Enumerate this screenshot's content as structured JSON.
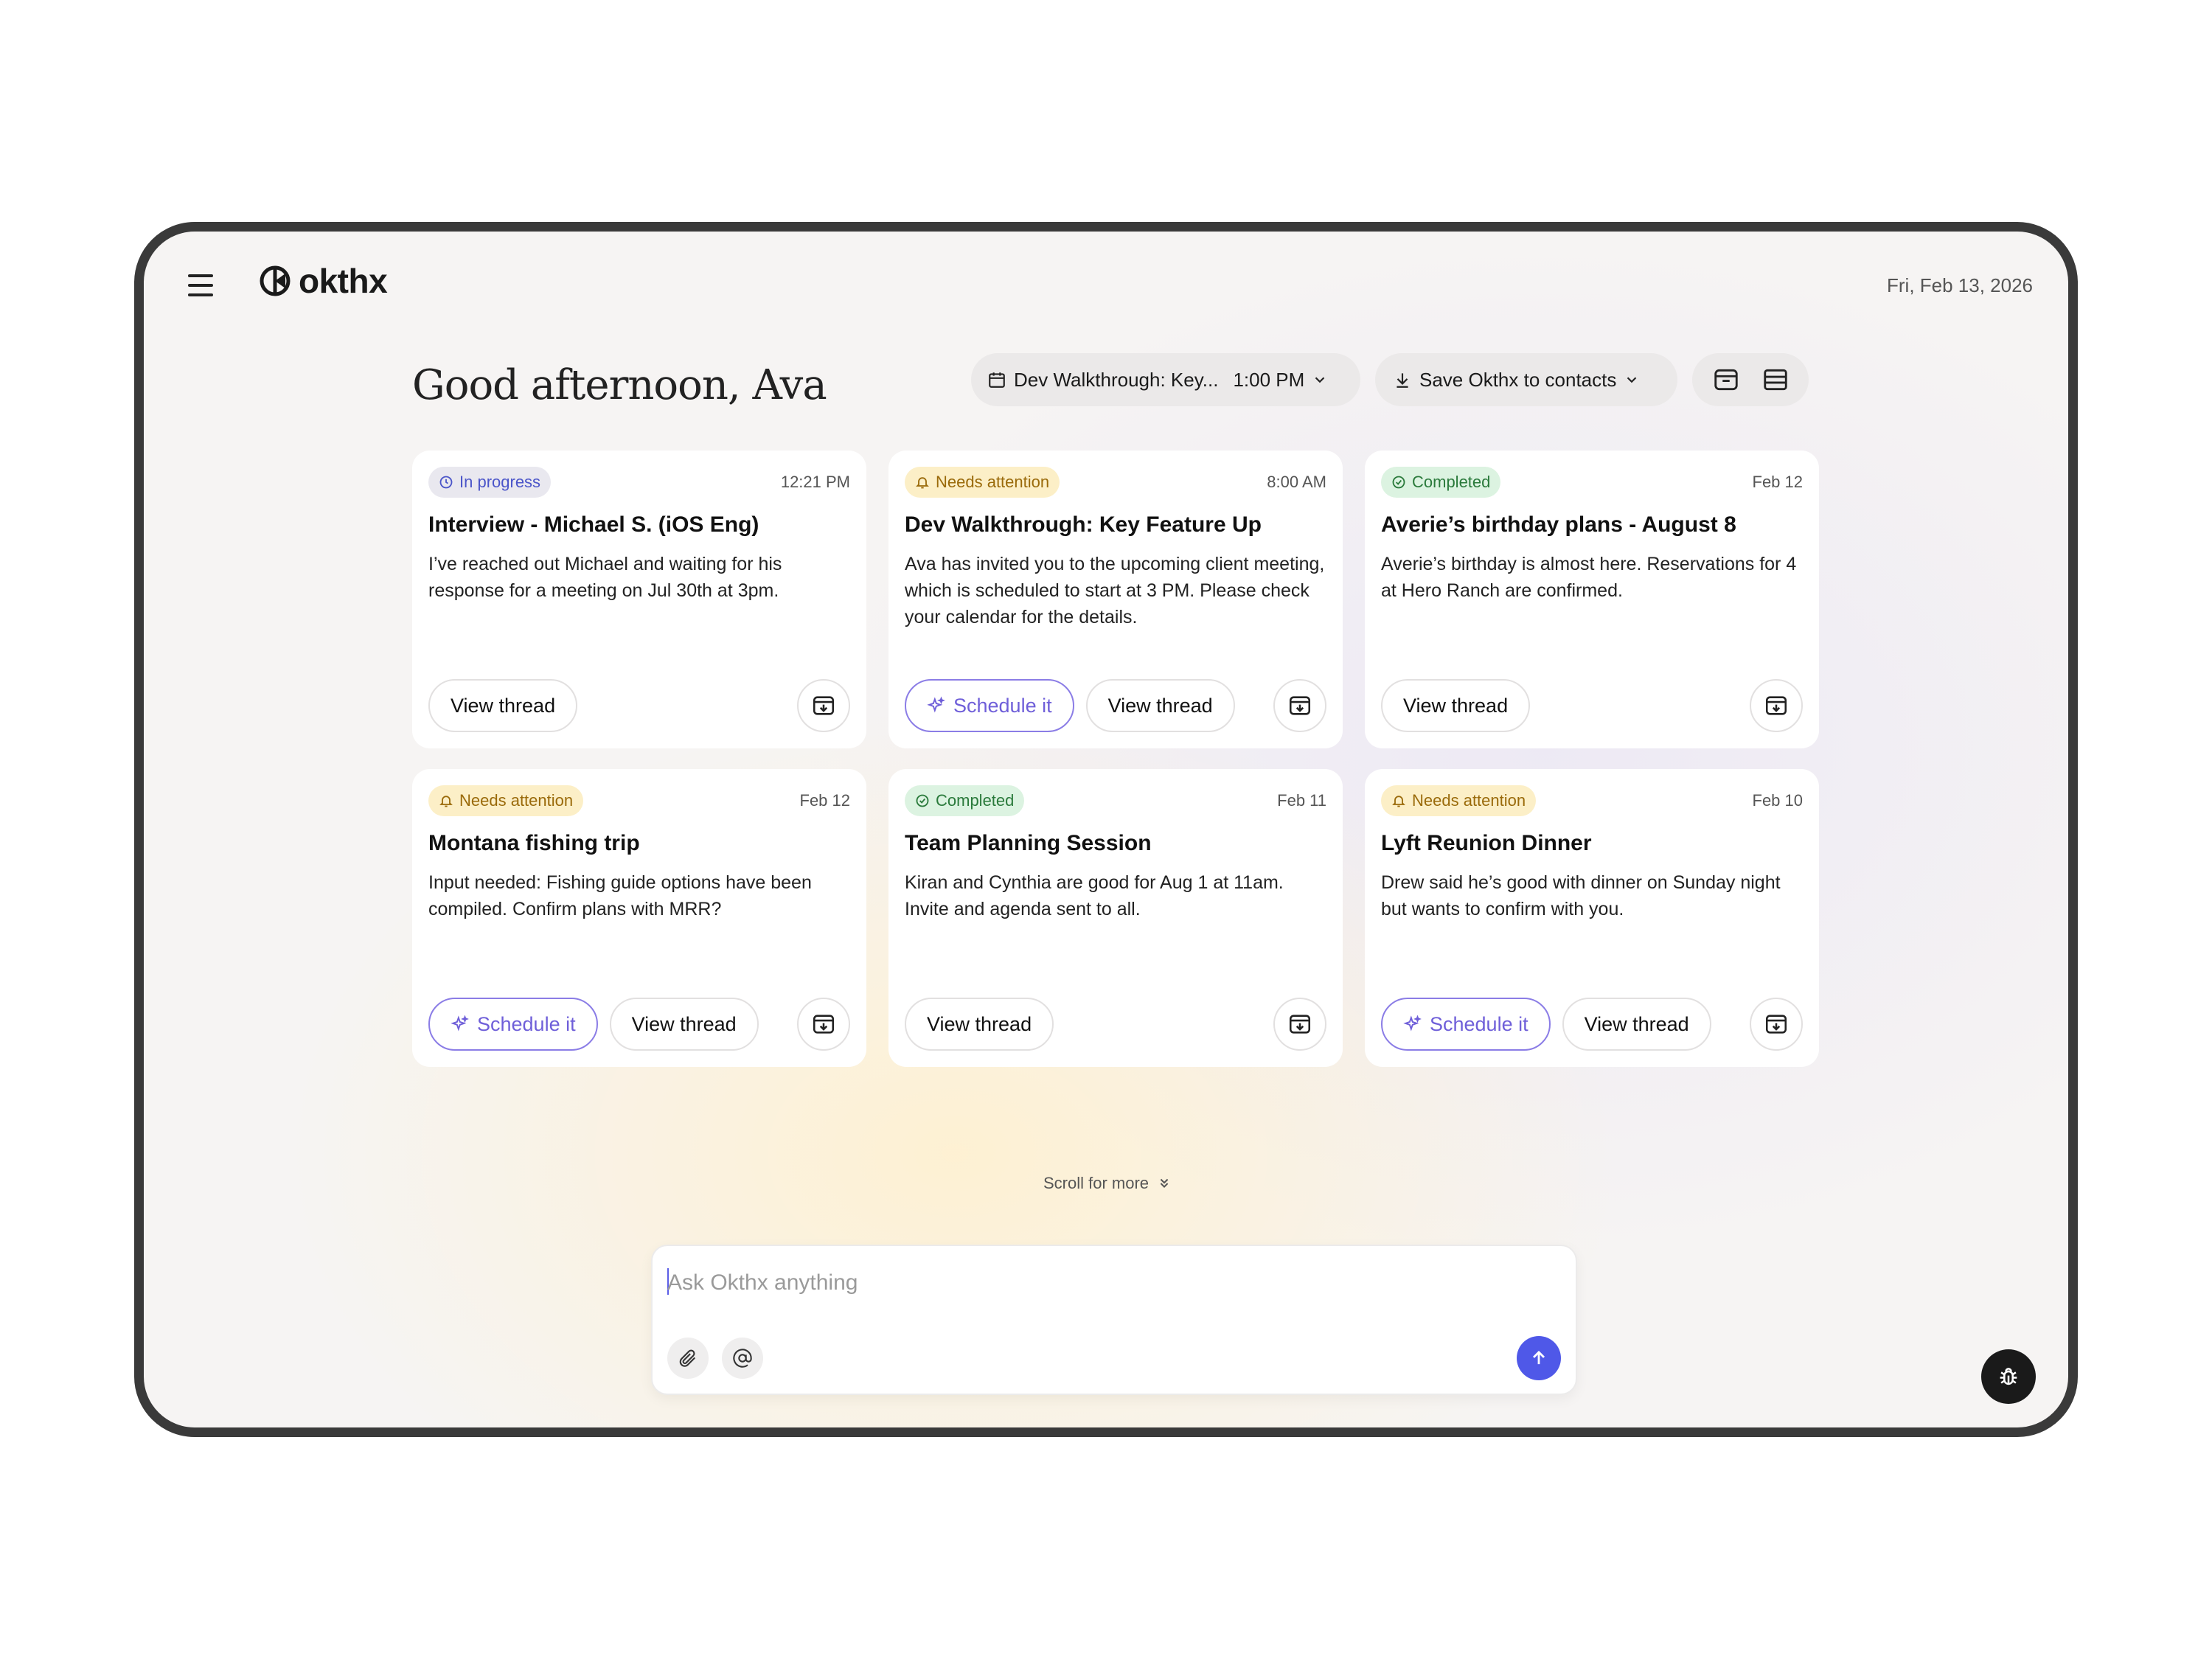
{
  "app": {
    "name": "okthx"
  },
  "header": {
    "date": "Fri, Feb 13, 2026"
  },
  "greeting": "Good afternoon, Ava",
  "toolbar": {
    "meeting_label": "Dev Walkthrough: Key...",
    "meeting_time": "1:00 PM",
    "save_contacts_label": "Save Okthx to contacts"
  },
  "cards": [
    {
      "status": "In progress",
      "status_type": "progress",
      "time": "12:21 PM",
      "title": "Interview - Michael S. (iOS Eng)",
      "body": "I’ve reached out Michael and waiting for his response for a meeting on Jul 30th at 3pm.",
      "schedule_label": "",
      "view_label": "View thread"
    },
    {
      "status": "Needs attention",
      "status_type": "attention",
      "time": "8:00 AM",
      "title": "Dev Walkthrough: Key Feature Up",
      "body": "Ava has invited you to the upcoming client meeting, which is scheduled to start at 3 PM. Please check your calendar for the details.",
      "schedule_label": "Schedule it",
      "view_label": "View thread"
    },
    {
      "status": "Completed",
      "status_type": "completed",
      "time": "Feb 12",
      "title": "Averie’s birthday plans - August 8",
      "body": "Averie’s birthday is almost here. Reservations for 4 at Hero Ranch are confirmed.",
      "schedule_label": "",
      "view_label": "View thread"
    },
    {
      "status": "Needs attention",
      "status_type": "attention",
      "time": "Feb 12",
      "title": "Montana fishing trip",
      "body": "Input needed: Fishing guide options have been compiled. Confirm plans with MRR?",
      "schedule_label": "Schedule it",
      "view_label": "View thread"
    },
    {
      "status": "Completed",
      "status_type": "completed",
      "time": "Feb 11",
      "title": "Team Planning Session",
      "body": "Kiran and Cynthia are good for Aug 1 at 11am. Invite and agenda sent to all.",
      "schedule_label": "",
      "view_label": "View thread"
    },
    {
      "status": "Needs attention",
      "status_type": "attention",
      "time": "Feb 10",
      "title": "Lyft Reunion Dinner",
      "body": "Drew said he’s good with dinner on Sunday night but wants to confirm with you.",
      "schedule_label": "Schedule it",
      "view_label": "View thread"
    }
  ],
  "scroll_hint": "Scroll for more",
  "composer": {
    "placeholder": "Ask Okthx anything",
    "value": ""
  },
  "colors": {
    "accent": "#4f58e8",
    "schedule": "#6f5fd9",
    "attention_bg": "#fcefc7",
    "completed_bg": "#dcf3e1",
    "progress_bg": "#e9e8ef"
  },
  "icons": {
    "menu": "hamburger-menu-icon",
    "calendar": "calendar-icon",
    "download": "download-icon",
    "archive": "archive-icon",
    "sparkle": "sparkle-icon",
    "attach": "paperclip-icon",
    "mention": "at-sign-icon",
    "send": "arrow-up-icon",
    "bug": "bug-icon"
  }
}
